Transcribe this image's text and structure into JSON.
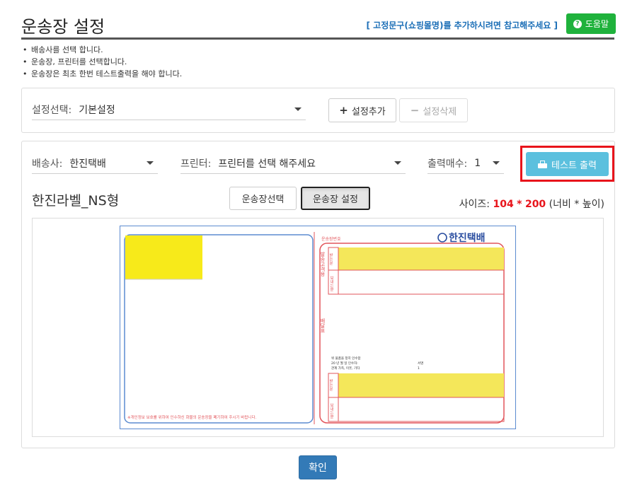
{
  "header": {
    "title": "운송장 설정",
    "ref_link": "[ 고정문구(쇼핑몰명)를 추가하시려면 참고해주세요 ]",
    "help_label": "도움말",
    "help_icon": "?"
  },
  "notes": [
    "배송사를 선택 합니다.",
    "운송장, 프린터를 선택합니다.",
    "운송장은 최초 한번 테스트출력을 해야 합니다."
  ],
  "settings_panel": {
    "select_label": "설정선택:",
    "select_value": "기본설정",
    "add_label": "설정추가",
    "delete_label": "설정삭제"
  },
  "print_panel": {
    "carrier_label": "배송사:",
    "carrier_value": "한진택배",
    "printer_label": "프린터:",
    "printer_value": "프린터를 선택 해주세요",
    "copies_label": "출력매수:",
    "copies_value": "1",
    "test_print_label": "테스트 출력",
    "label_name": "한진라벨_NS형",
    "tab_select_label": "운송장선택",
    "tab_setting_label": "운송장 설정",
    "size_prefix": "사이즈:",
    "size_width": "104",
    "size_sep": "*",
    "size_height": "200",
    "size_suffix": "(너비 * 높이)"
  },
  "label_preview": {
    "waybill_no_label": "운송장번호",
    "brand": "한진택배",
    "left_footer": "※개인정보 보호를 위하여 인수하신 화물의 운송장을 폐기하여 주시기 바랍니다.",
    "receiver_tag": "받는분",
    "sender_tag": "보내는분",
    "side_chars": "발송고객용",
    "lower_side_chars": "배달표",
    "receipt_line1": "위 물품을 정히 인수함",
    "receipt_line2": "20   년   월   일 인수자:",
    "receipt_line3": "관계 가족, 이웃, 기타",
    "receipt_right1": "서명",
    "receipt_right2": "1"
  },
  "confirm_label": "확인",
  "colors": {
    "help_green": "#1fb23c",
    "test_blue": "#5bc0de",
    "primary_blue": "#337ab7",
    "highlight_red": "#e8141b",
    "label_yellow": "#f7ea1a",
    "label_red": "#e2555b",
    "label_blue": "#5b8bd0"
  }
}
